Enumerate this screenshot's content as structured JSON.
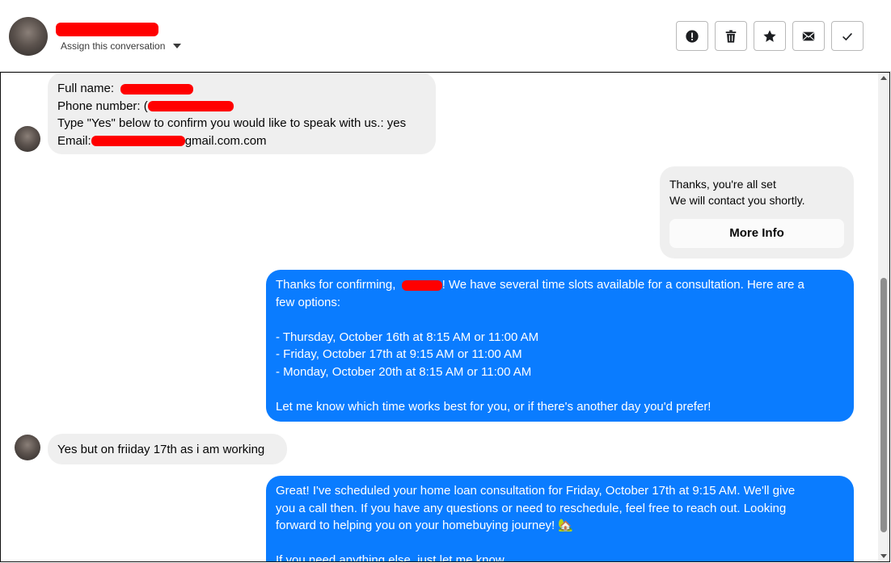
{
  "header": {
    "assign_label": "Assign this conversation",
    "actions": [
      {
        "icon": "alert-icon",
        "name": "mark-spam-button"
      },
      {
        "icon": "trash-icon",
        "name": "delete-button"
      },
      {
        "icon": "star-icon",
        "name": "star-button"
      },
      {
        "icon": "mail-icon",
        "name": "mark-unread-button"
      },
      {
        "icon": "check-icon",
        "name": "mark-done-button"
      }
    ]
  },
  "messages": {
    "form": {
      "full_name_label": "Full name:",
      "phone_label": "Phone number: (",
      "confirm_line": "Type \"Yes\" below to confirm you would like to speak with us.: yes",
      "email_label": "Email:",
      "email_suffix": "gmail.com.com"
    },
    "card": {
      "line1": "Thanks, you're all set",
      "line2": "We will contact you shortly.",
      "button": "More Info"
    },
    "out1": {
      "p1_before": "Thanks for confirming,",
      "p1_after": "! We have several time slots available for a consultation. Here are a",
      "p1_cont": "few options:",
      "opt1": "- Thursday, October 16th at 8:15 AM or 11:00 AM",
      "opt2": "- Friday, October 17th at 9:15 AM or 11:00 AM",
      "opt3": "- Monday, October 20th at 8:15 AM or 11:00 AM",
      "closing": "Let me know which time works best for you, or if there's another day you'd prefer!"
    },
    "in2": "Yes but on friiday 17th as i am working",
    "out2": {
      "l1": "Great! I've scheduled your home loan consultation for Friday, October 17th at 9:15 AM. We'll give",
      "l2": "you a call then. If you have any questions or need to reschedule, feel free to reach out. Looking",
      "l3": "forward to helping you on your homebuying journey! 🏡",
      "l4": "If you need anything else, just let me know."
    }
  },
  "colors": {
    "outgoing": "#0a7cff",
    "incoming": "#efefef",
    "redaction": "#ff0000"
  }
}
